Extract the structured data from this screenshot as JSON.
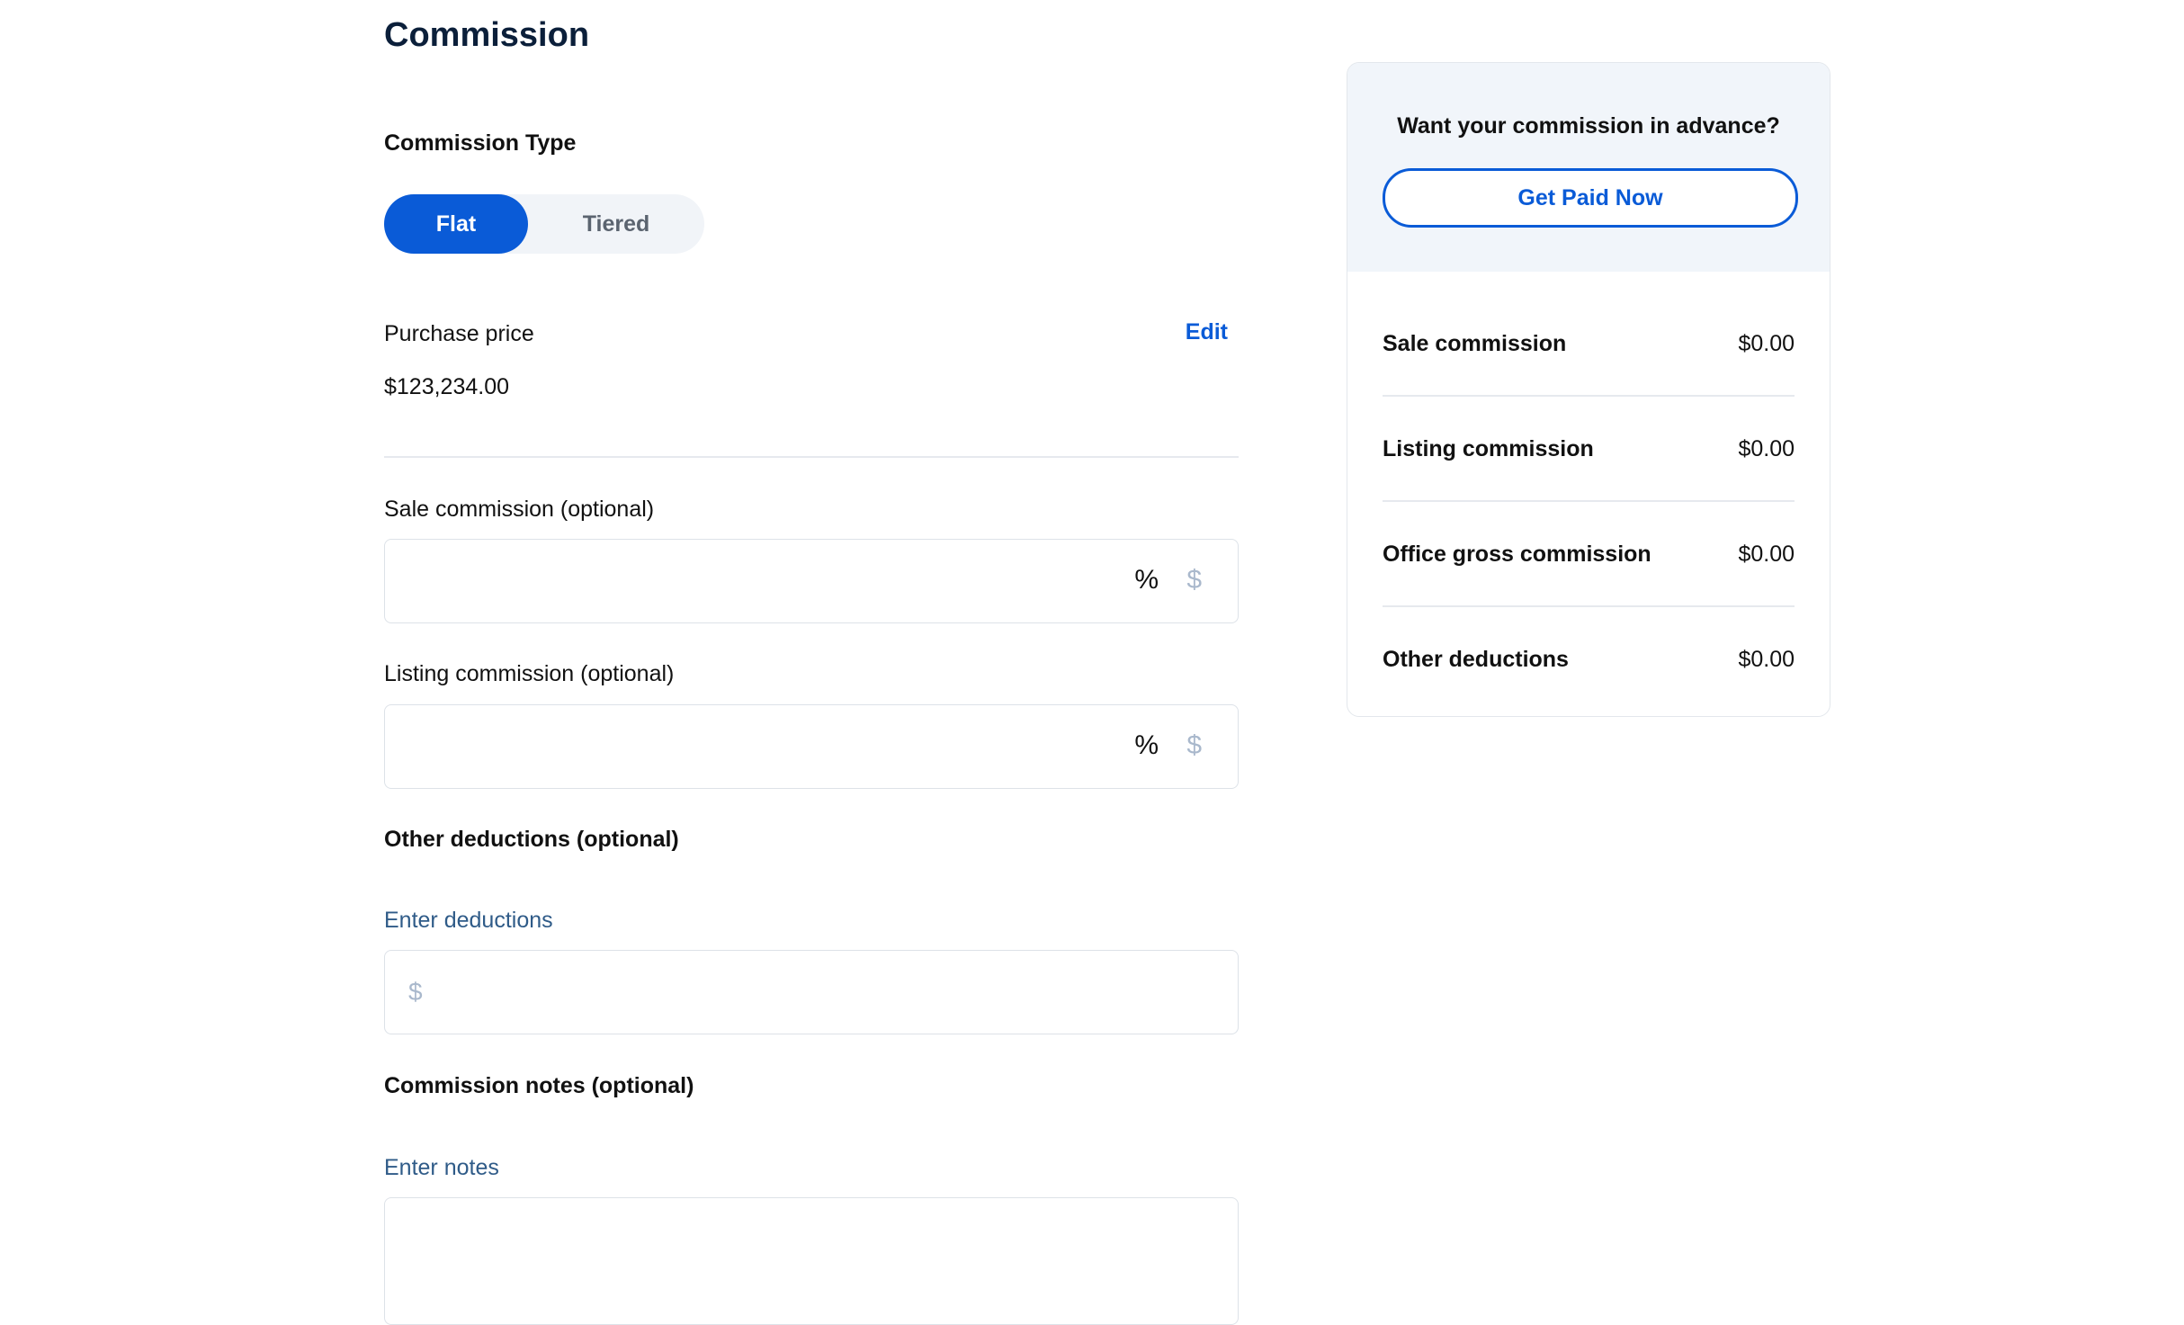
{
  "page": {
    "title": "Commission"
  },
  "commission_type": {
    "label": "Commission Type",
    "options": [
      "Flat",
      "Tiered"
    ],
    "selected": "Flat"
  },
  "purchase_price": {
    "label": "Purchase price",
    "value": "$123,234.00",
    "edit_label": "Edit"
  },
  "sale_commission": {
    "label": "Sale commission (optional)",
    "value": "",
    "percent_symbol": "%",
    "dollar_symbol": "$"
  },
  "listing_commission": {
    "label": "Listing commission (optional)",
    "value": "",
    "percent_symbol": "%",
    "dollar_symbol": "$"
  },
  "other_deductions": {
    "heading": "Other deductions (optional)",
    "label": "Enter deductions",
    "prefix": "$",
    "value": ""
  },
  "commission_notes": {
    "heading": "Commission notes (optional)",
    "label": "Enter notes",
    "value": ""
  },
  "sidebar": {
    "question": "Want your commission in advance?",
    "button_label": "Get Paid Now",
    "rows": [
      {
        "label": "Sale commission",
        "value": "$0.00"
      },
      {
        "label": "Listing commission",
        "value": "$0.00"
      },
      {
        "label": "Office gross commission",
        "value": "$0.00"
      },
      {
        "label": "Other deductions",
        "value": "$0.00"
      }
    ]
  },
  "colors": {
    "accent": "#0a5bd7",
    "title": "#0b1f3a",
    "muted_blue": "#2f5b88",
    "panel_bg": "#f1f5fa"
  }
}
